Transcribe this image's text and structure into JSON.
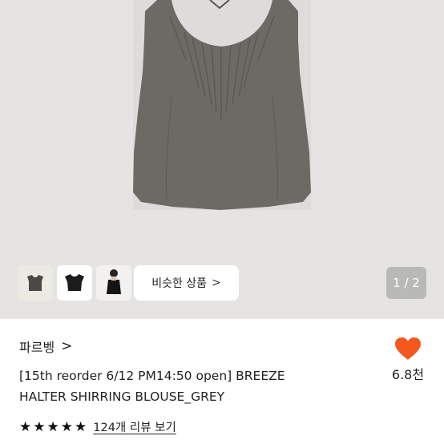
{
  "gallery": {
    "page_indicator": "1 / 2",
    "similar_label": "비슷한 상품",
    "thumbnails": [
      {
        "name": "grey-blouse-thumb"
      },
      {
        "name": "black-blouse-thumb"
      },
      {
        "name": "model-thumb"
      }
    ]
  },
  "product": {
    "store_name": "파르벵",
    "title_line1": "[15th reorder 6/12 PM14:50 open] BREEZE",
    "title_line2": "HALTER SHIRRING BLOUSE_GREY",
    "like_count": "6.8천",
    "rating_stars": 5,
    "review_link": "124개 리뷰 보기"
  },
  "colors": {
    "hero_bg": "#e5e4e2",
    "heart": "#f4581f",
    "garment_grey": "#6f6e69"
  }
}
